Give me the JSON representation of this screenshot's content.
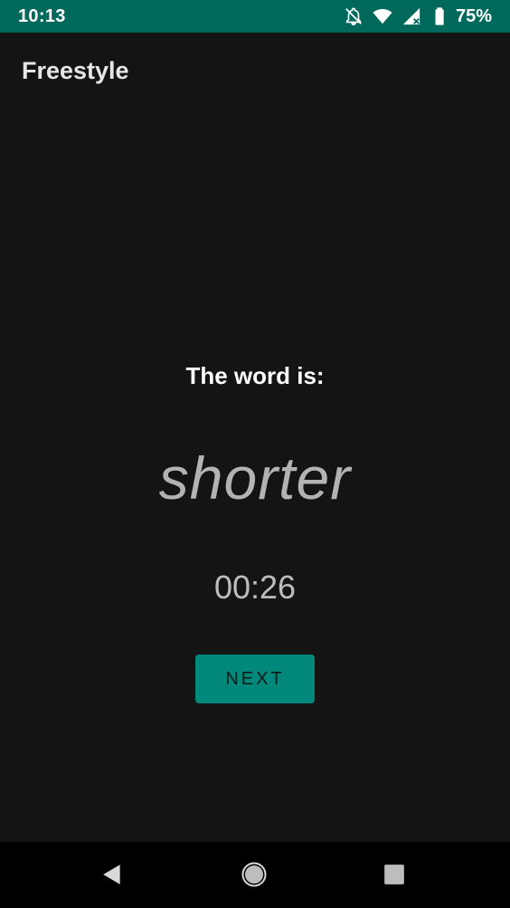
{
  "status_bar": {
    "time": "10:13",
    "battery_percent": "75%",
    "background_color": "#00695c",
    "icons": [
      "notifications-off-icon",
      "wifi-icon",
      "signal-icon",
      "battery-icon"
    ]
  },
  "app_bar": {
    "title": "Freestyle"
  },
  "main": {
    "prompt_label": "The word is:",
    "word": "shorter",
    "timer": "00:26",
    "next_button_label": "NEXT",
    "accent_color": "#00897b"
  },
  "nav_bar": {
    "icons": [
      "back-icon",
      "home-icon",
      "recents-icon"
    ]
  }
}
